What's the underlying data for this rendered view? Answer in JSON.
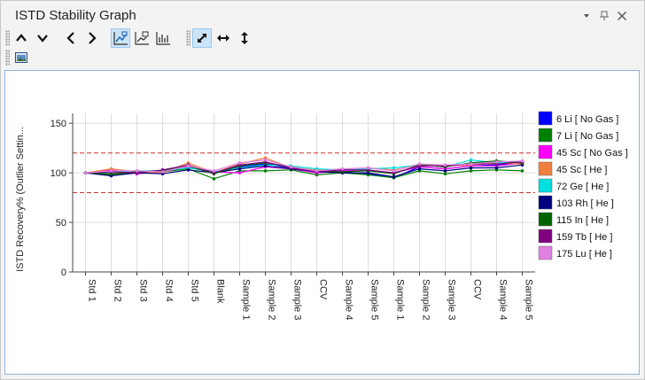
{
  "window": {
    "title": "ISTD Stability Graph",
    "dropdown_icon": "dropdown-arrow-icon",
    "pin_icon": "pin-icon",
    "close_icon": "close-icon"
  },
  "toolbar": {
    "row1": [
      "scroll-up-icon",
      "scroll-down-icon",
      "previous-icon",
      "next-icon",
      "chart-view-1-icon",
      "chart-view-2-icon",
      "chart-view-3-icon",
      "zoom-both-icon",
      "zoom-horizontal-icon",
      "zoom-vertical-icon"
    ],
    "row2": [
      "export-image-icon"
    ]
  },
  "colors": {
    "accent": "#cce4f7",
    "panel_border": "#8cb4dc",
    "limit_line": "#c83232"
  },
  "chart_data": {
    "type": "line",
    "ylabel": "ISTD Recovery% (Outlier Settin...",
    "ylim": [
      0,
      160
    ],
    "yticks": [
      0,
      50,
      100,
      150
    ],
    "limits": [
      80,
      120
    ],
    "grid": true,
    "legend_position": "right",
    "categories": [
      "Std 1",
      "Std 2",
      "Std 3",
      "Std 4",
      "Std 5",
      "Blank",
      "Sample 1",
      "Sample 2",
      "Sample 3",
      "CCV",
      "Sample 4",
      "Sample 5",
      "Sample 1",
      "Sample 2",
      "Sample 3",
      "CCV",
      "Sample 4",
      "Sample 5"
    ],
    "series": [
      {
        "name": "6 Li [ No Gas ]",
        "color": "#0000ff",
        "values": [
          100,
          99,
          101,
          102,
          106,
          100,
          106,
          109,
          105,
          101,
          101,
          99,
          95,
          106,
          104,
          107,
          108,
          110
        ]
      },
      {
        "name": "7 Li [ No Gas ]",
        "color": "#008000",
        "values": [
          100,
          98,
          100,
          101,
          104,
          94,
          102,
          102,
          103,
          98,
          100,
          98,
          95,
          102,
          99,
          102,
          103,
          102
        ]
      },
      {
        "name": "45 Sc [ No Gas ]",
        "color": "#ff00ff",
        "values": [
          100,
          103,
          99,
          101,
          106,
          101,
          100,
          106,
          104,
          100,
          102,
          102,
          100,
          106,
          104,
          107,
          107,
          110
        ]
      },
      {
        "name": "45 Sc [ He ]",
        "color": "#f08040",
        "values": [
          100,
          104,
          101,
          100,
          110,
          100,
          109,
          115,
          105,
          103,
          103,
          105,
          103,
          108,
          107,
          108,
          110,
          109
        ]
      },
      {
        "name": "72 Ge [ He ]",
        "color": "#00e0e0",
        "values": [
          100,
          101,
          102,
          102,
          105,
          101,
          105,
          108,
          107,
          104,
          103,
          104,
          105,
          108,
          106,
          113,
          110,
          111
        ]
      },
      {
        "name": "103 Rh [ He ]",
        "color": "#000080",
        "values": [
          100,
          97,
          100,
          99,
          103,
          100,
          104,
          107,
          104,
          101,
          100,
          100,
          96,
          104,
          102,
          105,
          105,
          108
        ]
      },
      {
        "name": "115 In [ He ]",
        "color": "#006400",
        "values": [
          100,
          99,
          101,
          102,
          107,
          99,
          107,
          110,
          106,
          102,
          101,
          102,
          99,
          108,
          106,
          110,
          112,
          110
        ]
      },
      {
        "name": "159 Tb [ He ]",
        "color": "#800080",
        "values": [
          100,
          101,
          100,
          103,
          108,
          100,
          108,
          111,
          105,
          101,
          103,
          103,
          100,
          107,
          107,
          109,
          109,
          111
        ]
      },
      {
        "name": "175 Lu [ He ]",
        "color": "#e080e0",
        "values": [
          100,
          102,
          102,
          101,
          107,
          102,
          110,
          113,
          106,
          102,
          104,
          105,
          102,
          109,
          108,
          109,
          111,
          112
        ]
      }
    ]
  }
}
